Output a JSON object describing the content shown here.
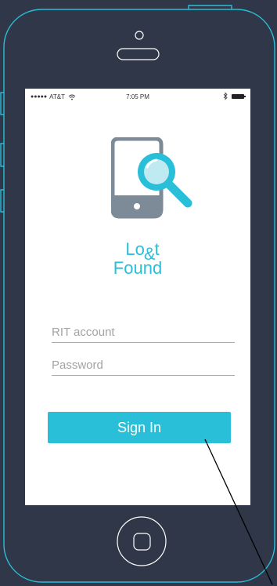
{
  "status_bar": {
    "carrier": "AT&T",
    "signal_dots": "●●●●●",
    "time": "7:05 PM"
  },
  "brand": {
    "line1_a": "Lo",
    "ampersand": "&",
    "line1_b": "t",
    "line2": "Found"
  },
  "login": {
    "account_placeholder": "RIT account",
    "password_placeholder": "Password",
    "sign_in_label": "Sign In"
  },
  "colors": {
    "background": "#2f3748",
    "outline": "#29bfd8",
    "accent": "#29bfd8",
    "icon_gray": "#7d8a98"
  },
  "icons": {
    "logo": "phone-magnifier-icon",
    "wifi": "wifi-icon",
    "bluetooth": "bluetooth-icon",
    "battery": "battery-icon",
    "home": "home-button-icon"
  }
}
